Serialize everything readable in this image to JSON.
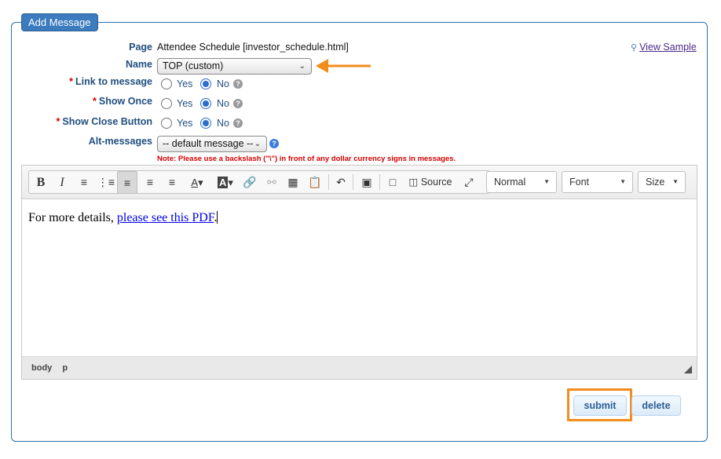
{
  "legend": "Add Message",
  "fields": {
    "page_label": "Page",
    "page_value": "Attendee Schedule [investor_schedule.html]",
    "name_label": "Name",
    "name_value": "TOP (custom)",
    "link_label": "Link to message",
    "show_once_label": "Show Once",
    "show_close_label": "Show Close Button",
    "alt_label": "Alt-messages",
    "alt_value": "-- default message --",
    "required_marker": "*",
    "yes_label": "Yes",
    "no_label": "No",
    "help_glyph": "?"
  },
  "radios": {
    "link_to_message": "No",
    "show_once": "No",
    "show_close_button": "No"
  },
  "view_sample": "View Sample",
  "note": "Note: Please use a backslash (\"\\\") in front of any dollar currency signs in messages.",
  "toolbar": {
    "source_label": "Source",
    "format_value": "Normal",
    "font_value": "Font",
    "size_value": "Size"
  },
  "editor": {
    "text_before": "For more details, ",
    "link_text": "please see this PDF",
    "text_after": "."
  },
  "statusbar": {
    "path": [
      "body",
      "p"
    ]
  },
  "actions": {
    "submit": "submit",
    "delete": "delete"
  },
  "colors": {
    "accent": "#3c7bbd",
    "highlight": "#f28c1b",
    "required": "#d40000"
  }
}
